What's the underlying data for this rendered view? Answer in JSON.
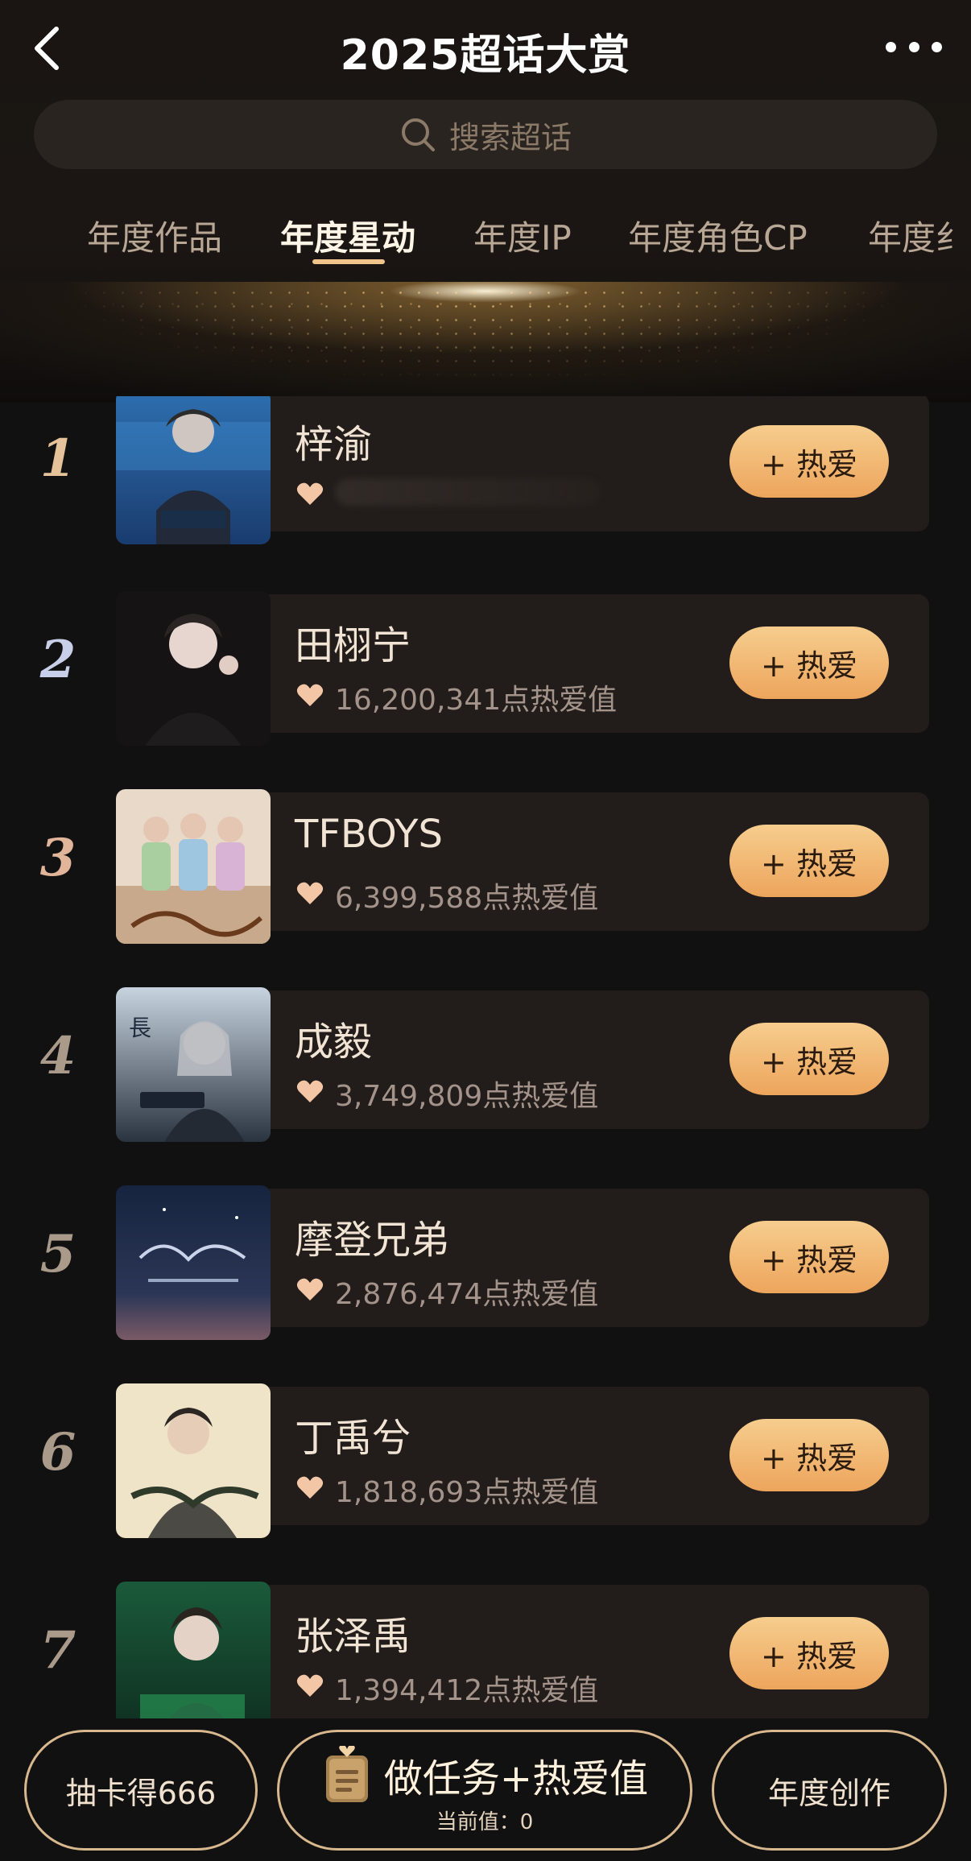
{
  "header": {
    "title": "2025超话大赏",
    "search_placeholder": "搜索超话",
    "tabs": [
      {
        "label": "年度作品",
        "active": false
      },
      {
        "label": "年度星动",
        "active": true
      },
      {
        "label": "年度IP",
        "active": false
      },
      {
        "label": "年度角色CP",
        "active": false
      },
      {
        "label": "年度纟",
        "active": false
      }
    ]
  },
  "colors": {
    "accent": "#f0c48a",
    "button_gradient_top": "#f6cd8e",
    "button_gradient_bottom": "#eda55c",
    "card_bg": "#221d1a",
    "page_bg": "#121111"
  },
  "list": {
    "items": [
      {
        "rank": "1",
        "name": "梓渝",
        "score": "",
        "button": "+ 热爱"
      },
      {
        "rank": "2",
        "name": "田栩宁",
        "score": "16,200,341点热爱值",
        "button": "+ 热爱"
      },
      {
        "rank": "3",
        "name": "TFBOYS",
        "score": "6,399,588点热爱值",
        "button": "+ 热爱"
      },
      {
        "rank": "4",
        "name": "成毅",
        "score": "3,749,809点热爱值",
        "button": "+ 热爱"
      },
      {
        "rank": "5",
        "name": "摩登兄弟",
        "score": "2,876,474点热爱值",
        "button": "+ 热爱"
      },
      {
        "rank": "6",
        "name": "丁禹兮",
        "score": "1,818,693点热爱值",
        "button": "+ 热爱"
      },
      {
        "rank": "7",
        "name": "张泽禹",
        "score": "1,394,412点热爱值",
        "button": "+ 热爱"
      }
    ]
  },
  "bottom": {
    "left_label": "抽卡得666",
    "mid_title": "做任务+热爱值",
    "mid_sub": "当前值：0",
    "right_label": "年度创作"
  }
}
